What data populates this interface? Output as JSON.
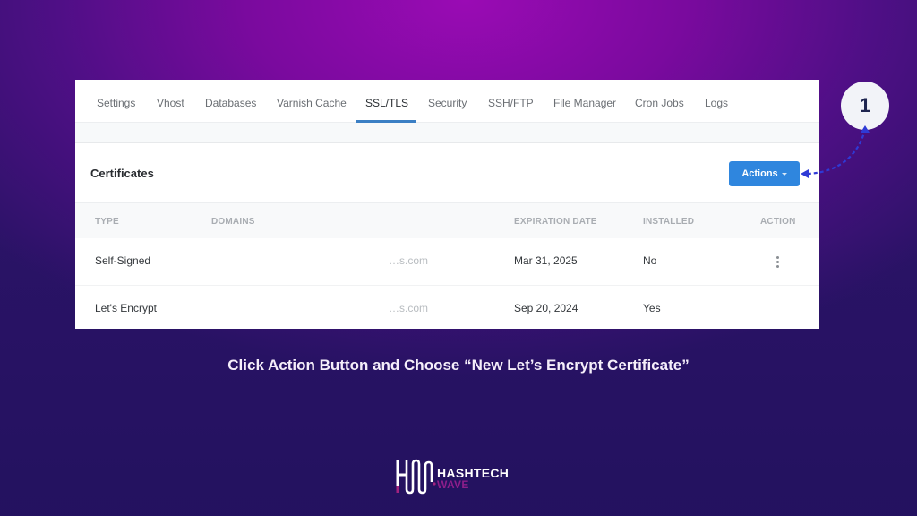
{
  "tabs": [
    {
      "label": "Settings",
      "active": false
    },
    {
      "label": "Vhost",
      "active": false
    },
    {
      "label": "Databases",
      "active": false
    },
    {
      "label": "Varnish Cache",
      "active": false
    },
    {
      "label": "SSL/TLS",
      "active": true
    },
    {
      "label": "Security",
      "active": false
    },
    {
      "label": "SSH/FTP",
      "active": false
    },
    {
      "label": "File Manager",
      "active": false
    },
    {
      "label": "Cron Jobs",
      "active": false
    },
    {
      "label": "Logs",
      "active": false
    }
  ],
  "section": {
    "title": "Certificates",
    "actions_label": "Actions"
  },
  "table": {
    "headers": [
      "TYPE",
      "DOMAINS",
      "EXPIRATION DATE",
      "INSTALLED",
      "ACTION"
    ],
    "rows": [
      {
        "type": "Self-Signed",
        "domain": "…s.com",
        "expiration": "Mar 31, 2025",
        "installed": "No",
        "has_menu": true
      },
      {
        "type": "Let's Encrypt",
        "domain": "…s.com",
        "expiration": "Sep 20, 2024",
        "installed": "Yes",
        "has_menu": false
      }
    ]
  },
  "annotation": {
    "step_number": "1",
    "caption": "Click Action Button and Choose “New Let’s Encrypt Certificate”"
  },
  "brand": {
    "line1": "HASHTECH",
    "line2": "WAVE"
  },
  "colors": {
    "accent_blue": "#2f86de",
    "tab_underline": "#3b7fc4",
    "background_top": "#9a0bb4",
    "background_bottom": "#2a1366",
    "arrow": "#2f3ad6"
  }
}
